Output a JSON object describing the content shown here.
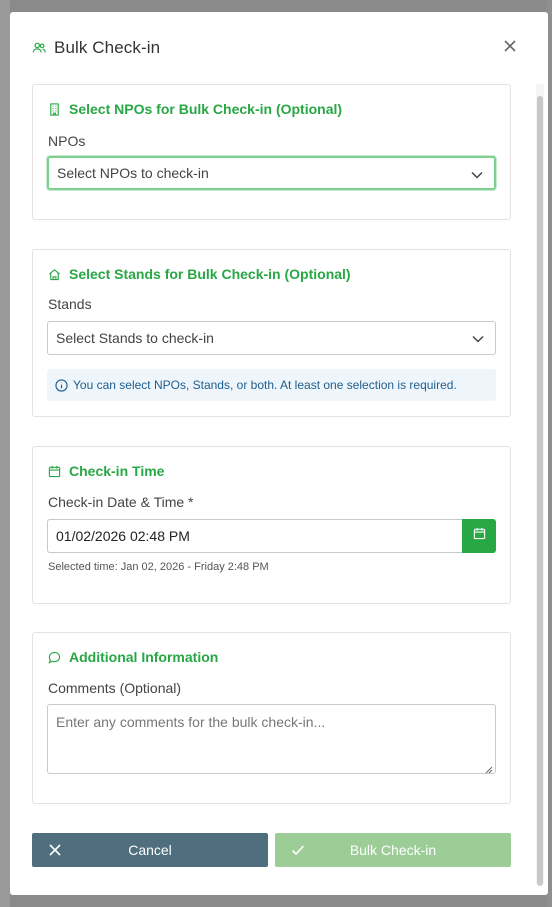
{
  "modal": {
    "title": "Bulk Check-in",
    "header_icon": "users-icon",
    "close_icon": "close-icon"
  },
  "npo_section": {
    "title": "Select NPOs for Bulk Check-in (Optional)",
    "icon": "building-icon",
    "field_label": "NPOs",
    "select_placeholder": "Select NPOs to check-in"
  },
  "stands_section": {
    "title": "Select Stands for Bulk Check-in (Optional)",
    "icon": "home-icon",
    "field_label": "Stands",
    "select_placeholder": "Select Stands to check-in",
    "info_text": "You can select NPOs, Stands, or both. At least one selection is required."
  },
  "time_section": {
    "title": "Check-in Time",
    "icon": "calendar-icon",
    "field_label": "Check-in Date & Time *",
    "value": "01/02/2026 02:48 PM",
    "selected_text": "Selected time: Jan 02, 2026 - Friday 2:48 PM"
  },
  "info_section": {
    "title": "Additional Information",
    "icon": "chat-bubble-icon",
    "field_label": "Comments (Optional)",
    "comments_placeholder": "Enter any comments for the bulk check-in..."
  },
  "footer": {
    "cancel_label": "Cancel",
    "submit_label": "Bulk Check-in"
  },
  "colors": {
    "accent": "#28a745",
    "cancel_bg": "#4f6f7f",
    "submit_bg": "#9ccd96",
    "info_bg": "#eef5fb",
    "info_text": "#1f5e8c"
  }
}
